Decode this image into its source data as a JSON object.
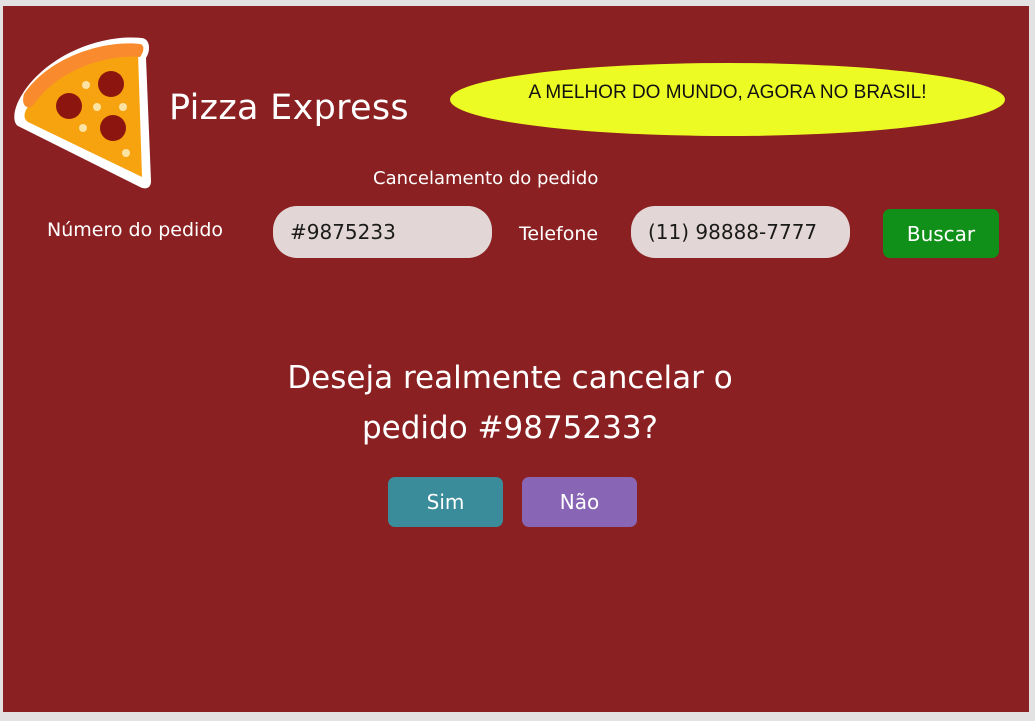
{
  "header": {
    "brand": "Pizza Express",
    "slogan": "A MELHOR DO MUNDO, AGORA NO BRASIL!",
    "logo_icon": "pizza-slice-icon"
  },
  "form": {
    "title": "Cancelamento do pedido",
    "order_label": "Número do pedido",
    "order_value": "#9875233",
    "phone_label": "Telefone",
    "phone_value": "(11) 98888-7777",
    "search_button": "Buscar"
  },
  "dialog": {
    "question_line1": "Deseja realmente cancelar o",
    "question_line2": "pedido #9875233?",
    "yes_button": "Sim",
    "no_button": "Não"
  },
  "colors": {
    "background": "#8a2021",
    "slogan_bg": "#ecfb24",
    "search_button": "#119019",
    "yes_button": "#3a8c9b",
    "no_button": "#8866b5"
  }
}
